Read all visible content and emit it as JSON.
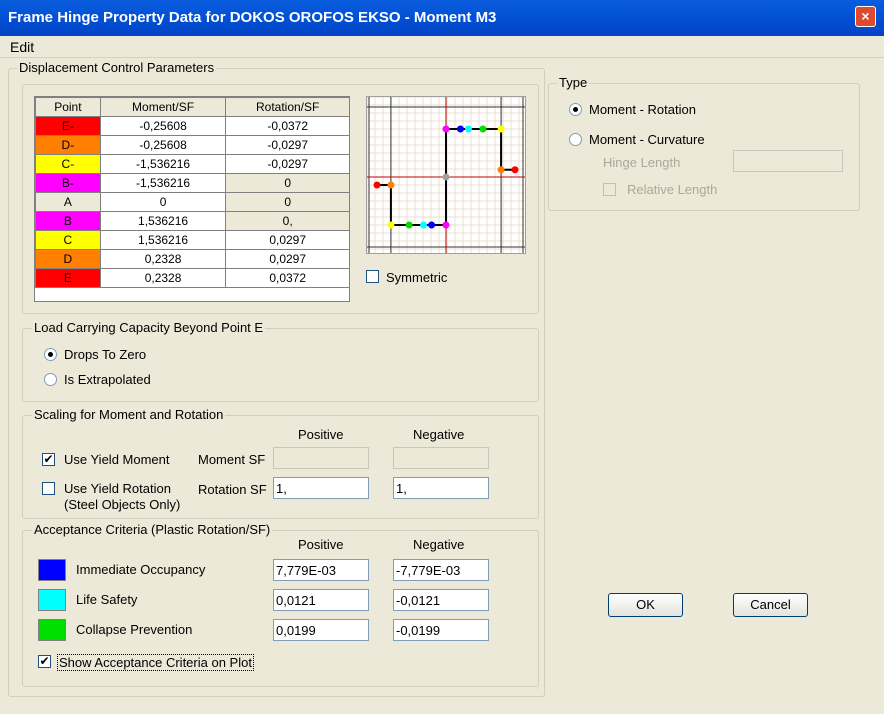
{
  "window": {
    "title": "Frame Hinge Property Data for DOKOS OROFOS EKSO - Moment M3",
    "close": "×"
  },
  "menu": {
    "edit": "Edit"
  },
  "displacement": {
    "group_label": "Displacement Control Parameters",
    "headers": [
      "Point",
      "Moment/SF",
      "Rotation/SF"
    ],
    "rows": [
      {
        "point": "E-",
        "moment": "-0,25608",
        "rotation": "-0,0372",
        "color": "#FF0000",
        "rot_editable": true
      },
      {
        "point": "D-",
        "moment": "-0,25608",
        "rotation": "-0,0297",
        "color": "#FF8000",
        "rot_editable": true
      },
      {
        "point": "C-",
        "moment": "-1,536216",
        "rotation": "-0,0297",
        "color": "#FFFF00",
        "rot_editable": true
      },
      {
        "point": "B-",
        "moment": "-1,536216",
        "rotation": "0",
        "color": "#FF00FF",
        "rot_editable": false
      },
      {
        "point": "A",
        "moment": "0",
        "rotation": "0",
        "color": "#ECE9D8",
        "rot_editable": false
      },
      {
        "point": "B",
        "moment": "1,536216",
        "rotation": "0,",
        "color": "#FF00FF",
        "rot_editable": false
      },
      {
        "point": "C",
        "moment": "1,536216",
        "rotation": "0,0297",
        "color": "#FFFF00",
        "rot_editable": true
      },
      {
        "point": "D",
        "moment": "0,2328",
        "rotation": "0,0297",
        "color": "#FF8000",
        "rot_editable": true
      },
      {
        "point": "E",
        "moment": "0,2328",
        "rotation": "0,0372",
        "color": "#FF0000",
        "rot_editable": true
      }
    ],
    "symmetric_label": "Symmetric",
    "symmetric_checked": false
  },
  "plot": {
    "curve_color": "#000000",
    "axis_color": "#C00000",
    "points": [
      {
        "rot": -0.0372,
        "mom": -0.25608,
        "color": "#FF0000"
      },
      {
        "rot": -0.0297,
        "mom": -0.25608,
        "color": "#FF8000"
      },
      {
        "rot": -0.0297,
        "mom": -1.536216,
        "color": "#FFFF00"
      },
      {
        "rot": -0.0199,
        "mom": -1.536216,
        "color": "#00E000"
      },
      {
        "rot": -0.0121,
        "mom": -1.536216,
        "color": "#00FFFF"
      },
      {
        "rot": -0.007779,
        "mom": -1.536216,
        "color": "#0000FF"
      },
      {
        "rot": 0,
        "mom": -1.536216,
        "color": "#FF00FF"
      },
      {
        "rot": 0,
        "mom": 0,
        "color": "#A0A0A0"
      },
      {
        "rot": 0,
        "mom": 1.536216,
        "color": "#FF00FF"
      },
      {
        "rot": 0.007779,
        "mom": 1.536216,
        "color": "#0000FF"
      },
      {
        "rot": 0.0121,
        "mom": 1.536216,
        "color": "#00FFFF"
      },
      {
        "rot": 0.0199,
        "mom": 1.536216,
        "color": "#00E000"
      },
      {
        "rot": 0.0297,
        "mom": 1.536216,
        "color": "#FFFF00"
      },
      {
        "rot": 0.0297,
        "mom": 0.2328,
        "color": "#FF8000"
      },
      {
        "rot": 0.0372,
        "mom": 0.2328,
        "color": "#FF0000"
      }
    ]
  },
  "type": {
    "group_label": "Type",
    "moment_rotation": "Moment - Rotation",
    "moment_curvature": "Moment - Curvature",
    "hinge_length": "Hinge Length",
    "relative_length": "Relative Length",
    "selected": "moment_rotation"
  },
  "load_capacity": {
    "group_label": "Load Carrying Capacity Beyond Point E",
    "drops_to_zero": "Drops To Zero",
    "is_extrapolated": "Is Extrapolated",
    "selected": "drops_to_zero"
  },
  "scaling": {
    "group_label": "Scaling for Moment and Rotation",
    "positive": "Positive",
    "negative": "Negative",
    "use_yield_moment": "Use Yield Moment",
    "use_yield_moment_checked": true,
    "moment_sf": "Moment SF",
    "moment_sf_pos": "",
    "moment_sf_neg": "",
    "use_yield_rotation": "Use Yield Rotation",
    "steel_only": "(Steel Objects Only)",
    "use_yield_rotation_checked": false,
    "rotation_sf": "Rotation SF",
    "rotation_sf_pos": "1,",
    "rotation_sf_neg": "1,"
  },
  "acceptance": {
    "group_label": "Acceptance Criteria (Plastic Rotation/SF)",
    "positive": "Positive",
    "negative": "Negative",
    "criteria": [
      {
        "name": "Immediate Occupancy",
        "color": "#0000FF",
        "pos": "7,779E-03",
        "neg": "-7,779E-03"
      },
      {
        "name": "Life Safety",
        "color": "#00FFFF",
        "pos": "0,0121",
        "neg": "-0,0121"
      },
      {
        "name": "Collapse Prevention",
        "color": "#00E000",
        "pos": "0,0199",
        "neg": "-0,0199"
      }
    ],
    "show_on_plot": "Show Acceptance Criteria on Plot",
    "show_on_plot_checked": true
  },
  "buttons": {
    "ok": "OK",
    "cancel": "Cancel"
  }
}
